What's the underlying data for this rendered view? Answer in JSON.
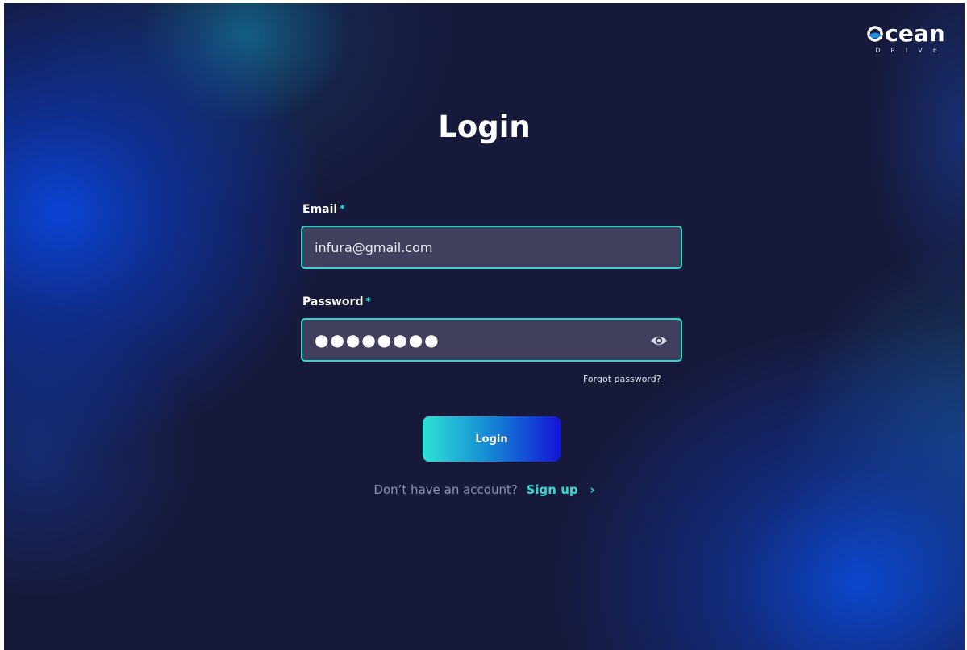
{
  "brand": {
    "logo_word": "cean",
    "logo_sub": "DRIVE"
  },
  "page": {
    "title": "Login"
  },
  "form": {
    "email": {
      "label": "Email",
      "required_marker": "*",
      "value": "infura@gmail.com"
    },
    "password": {
      "label": "Password",
      "required_marker": "*",
      "masked_value": "●●●●●●●●",
      "toggle_icon": "eye-icon"
    },
    "forgot_label": "Forgot password?",
    "submit_label": "Login"
  },
  "footer": {
    "question": "Don’t have an account?",
    "signup_label": "Sign up",
    "chevron": "›"
  },
  "colors": {
    "accent": "#2fd8cc",
    "background": "#16193a",
    "button_start": "#2de2d6",
    "button_end": "#1414d6"
  }
}
